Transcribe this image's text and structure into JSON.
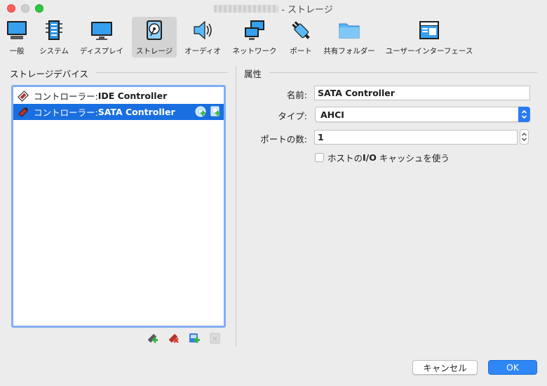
{
  "window": {
    "title": "- ストレージ"
  },
  "toolbar": {
    "items": [
      {
        "label": "一般",
        "icon": "monitor-general-icon"
      },
      {
        "label": "システム",
        "icon": "chip-icon"
      },
      {
        "label": "ディスプレイ",
        "icon": "display-icon"
      },
      {
        "label": "ストレージ",
        "icon": "disk-icon",
        "selected": true
      },
      {
        "label": "オーディオ",
        "icon": "speaker-icon"
      },
      {
        "label": "ネットワーク",
        "icon": "network-icon"
      },
      {
        "label": "ポート",
        "icon": "port-plug-icon"
      },
      {
        "label": "共有フォルダー",
        "icon": "folder-icon"
      },
      {
        "label": "ユーザーインターフェース",
        "icon": "ui-window-icon"
      }
    ]
  },
  "storage": {
    "header": "ストレージデバイス",
    "controllers": [
      {
        "prefix": "コントローラー: ",
        "name": "IDE Controller",
        "icon": "ide-controller-icon"
      },
      {
        "prefix": "コントローラー: ",
        "name": "SATA Controller",
        "icon": "sata-controller-icon",
        "selected": true
      }
    ]
  },
  "attributes": {
    "header": "属性",
    "name_label": "名前:",
    "name_value": "SATA Controller",
    "type_label": "タイプ:",
    "type_value": "AHCI",
    "ports_label": "ポートの数:",
    "ports_value": "1",
    "cache_label_pre": "ホストの",
    "cache_label_bold": "I/O",
    "cache_label_post": " キャッシュを使う",
    "cache_checked": false
  },
  "buttons": {
    "cancel": "キャンセル",
    "ok": "OK"
  },
  "colors": {
    "selection": "#1a6fe0",
    "accent": "#2f87f5",
    "focus_ring": "#80aef4"
  }
}
